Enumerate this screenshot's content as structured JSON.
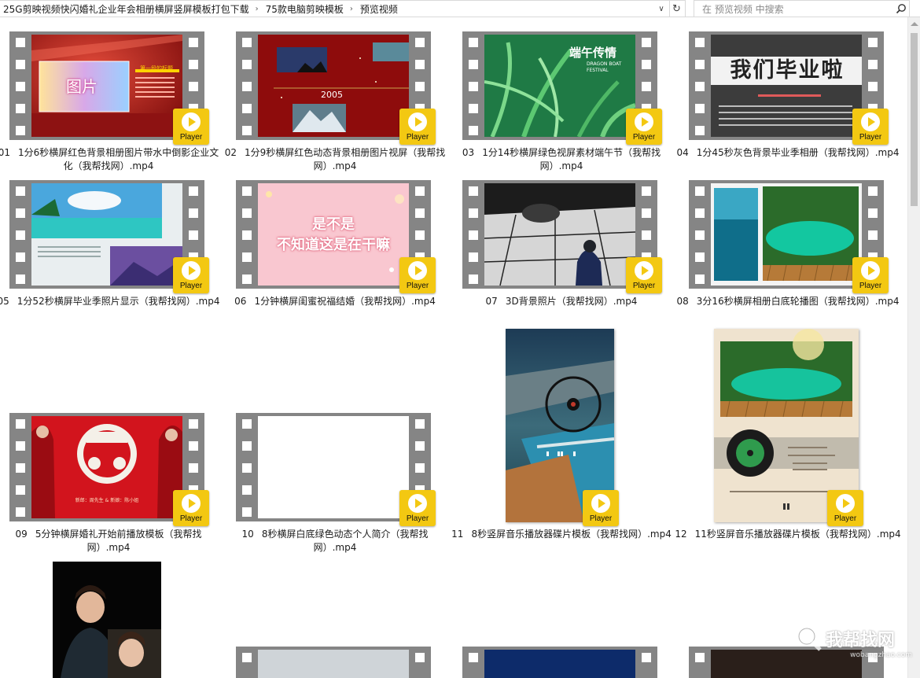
{
  "breadcrumb": [
    "25G剪映视频快闪婚礼企业年会相册横屏竖屏模板打包下载",
    "75款电脑剪映模板",
    "预览视频"
  ],
  "search": {
    "placeholder": "在 预览视频 中搜索"
  },
  "badge_label": "Player",
  "art_text": {
    "t1_image": "图片",
    "t1_heading": "第一段的标题",
    "t2_year": "2005",
    "t3_title": "端午传情",
    "t3_sub": "DRAGON BOAT FESTIVAL",
    "t4_title": "我们毕业啦",
    "t6_line1": "是不是",
    "t6_line2": "不知道这是在干嘛",
    "t9_bride": "新郎：周先生 & 新娘：陈小姐"
  },
  "items": [
    {
      "num": "01",
      "title": "1分6秒横屏红色背景相册图片带水中倒影企业文化（我帮找网）.mp4"
    },
    {
      "num": "02",
      "title": "1分9秒横屏红色动态背景相册图片视屏（我帮找网）.mp4"
    },
    {
      "num": "03",
      "title": "1分14秒横屏绿色视屏素材端午节（我帮找网）.mp4"
    },
    {
      "num": "04",
      "title": "1分45秒灰色背景毕业季相册（我帮找网）.mp4"
    },
    {
      "num": "05",
      "title": "1分52秒横屏毕业季照片显示（我帮找网）.mp4"
    },
    {
      "num": "06",
      "title": "1分钟横屏闺蜜祝福结婚（我帮找网）.mp4"
    },
    {
      "num": "07",
      "title": "3D背景照片（我帮找网）.mp4"
    },
    {
      "num": "08",
      "title": "3分16秒横屏相册白底轮播图（我帮找网）.mp4"
    },
    {
      "num": "09",
      "title": "5分钟横屏婚礼开始前播放模板（我帮找网）.mp4"
    },
    {
      "num": "10",
      "title": "8秒横屏白底绿色动态个人简介（我帮找网）.mp4"
    },
    {
      "num": "11",
      "title": "8秒竖屏音乐播放器碟片模板（我帮找网）.mp4"
    },
    {
      "num": "12",
      "title": "11秒竖屏音乐播放器碟片模板（我帮找网）.mp4"
    }
  ],
  "watermark": {
    "text": "我帮找网",
    "url": "wobangzhao.com"
  }
}
